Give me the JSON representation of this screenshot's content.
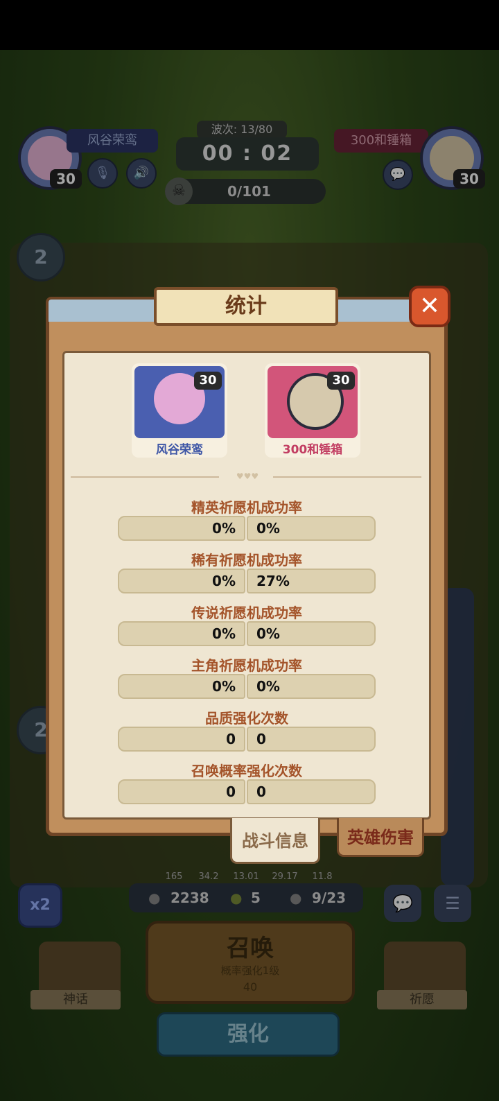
{
  "background": {
    "left_player": {
      "name": "风谷荣鸾",
      "level": "30"
    },
    "right_player": {
      "name": "300和锤箱",
      "level": "30"
    },
    "wave": "波次: 13/80",
    "timer": "00 : 02",
    "kills": "0/101",
    "bubble_top": "2",
    "bubble_mid": "2",
    "stats": [
      "165",
      "34.2",
      "13.01",
      "29.17",
      "11.8"
    ],
    "resources": {
      "coins": "2238",
      "clover": "5",
      "units": "9/23"
    },
    "x2": "x2",
    "summon": {
      "title": "召唤",
      "subtitle": "概率强化1级",
      "cost": "40"
    },
    "left_label": "神话",
    "right_label": "祈愿",
    "enhance": "强化"
  },
  "modal": {
    "title": "统计",
    "close_icon": "close-icon",
    "players": [
      {
        "name": "风谷荣鸾",
        "level": "30",
        "color": "#4a5fb0"
      },
      {
        "name": "300和锤箱",
        "level": "30",
        "color": "#d2557a"
      }
    ],
    "stats": [
      {
        "label": "精英祈愿机成功率",
        "left": "0%",
        "right": "0%"
      },
      {
        "label": "稀有祈愿机成功率",
        "left": "0%",
        "right": "27%"
      },
      {
        "label": "传说祈愿机成功率",
        "left": "0%",
        "right": "0%"
      },
      {
        "label": "主角祈愿机成功率",
        "left": "0%",
        "right": "0%"
      },
      {
        "label": "品质强化次数",
        "left": "0",
        "right": "0"
      },
      {
        "label": "召唤概率强化次数",
        "left": "0",
        "right": "0"
      }
    ],
    "tabs": {
      "active": "战斗信息",
      "inactive": "英雄伤害"
    }
  }
}
